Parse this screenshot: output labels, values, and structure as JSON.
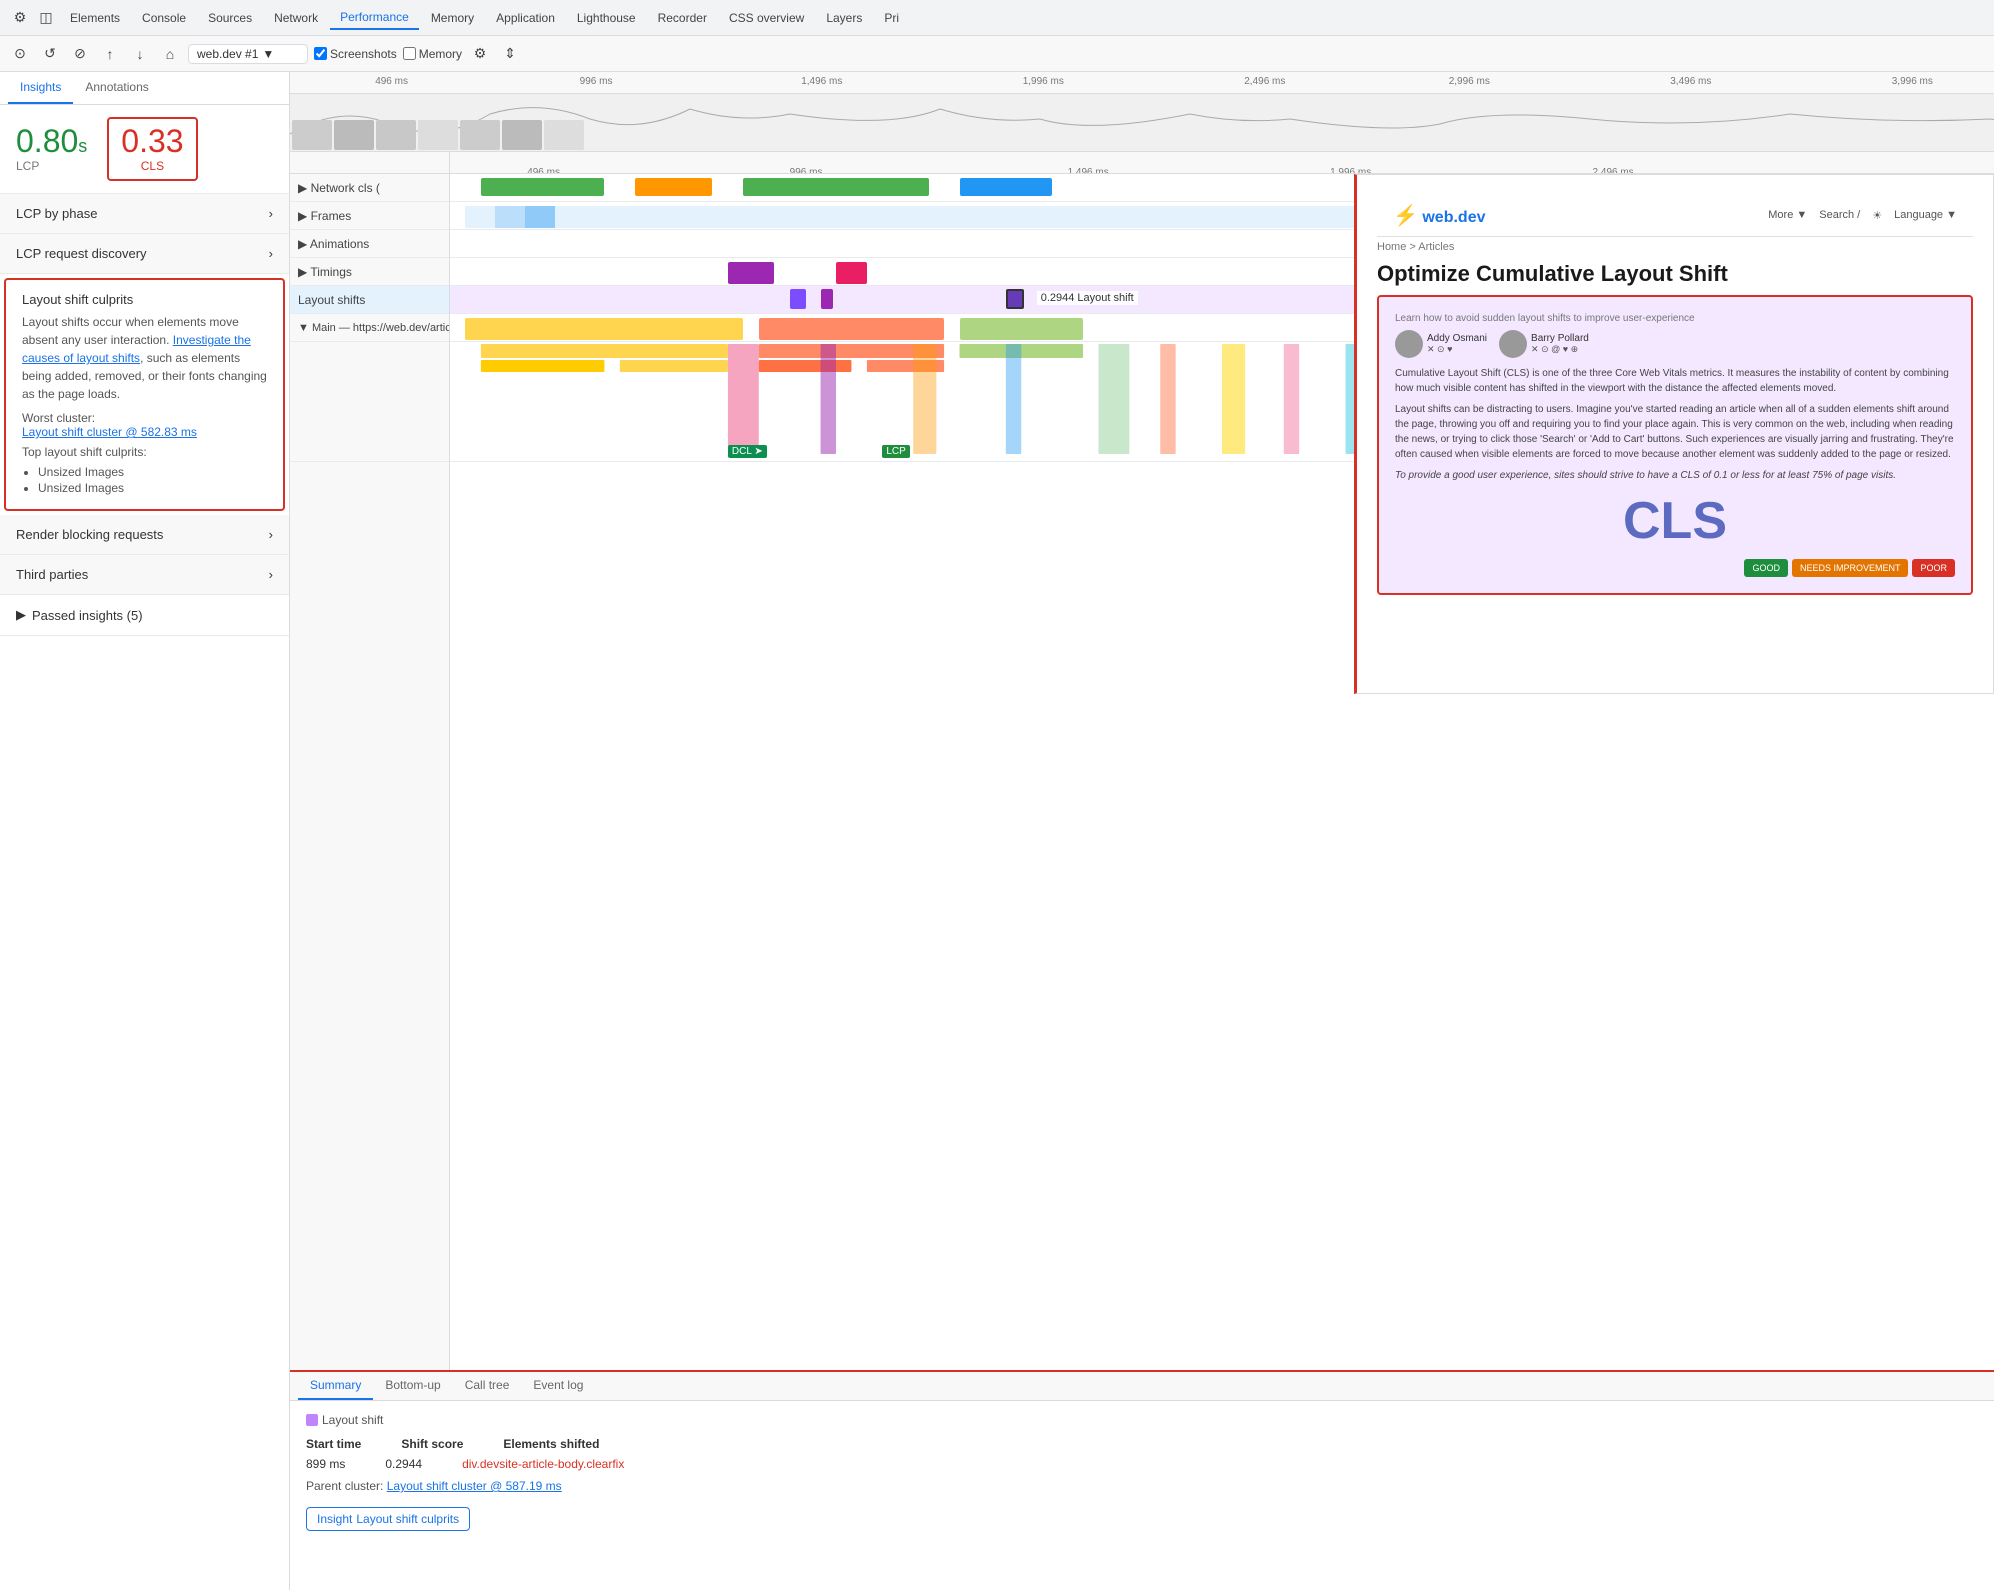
{
  "menuBar": {
    "items": [
      {
        "label": "Elements",
        "active": false
      },
      {
        "label": "Console",
        "active": false
      },
      {
        "label": "Sources",
        "active": false
      },
      {
        "label": "Network",
        "active": false
      },
      {
        "label": "Performance",
        "active": true
      },
      {
        "label": "Memory",
        "active": false
      },
      {
        "label": "Application",
        "active": false
      },
      {
        "label": "Lighthouse",
        "active": false
      },
      {
        "label": "Recorder",
        "active": false
      },
      {
        "label": "CSS overview",
        "active": false
      },
      {
        "label": "Layers",
        "active": false
      },
      {
        "label": "Pri",
        "active": false
      }
    ]
  },
  "toolbar": {
    "urlLabel": "web.dev #1",
    "screenshotsLabel": "Screenshots",
    "memoryLabel": "Memory"
  },
  "leftPanel": {
    "tabs": [
      {
        "label": "Insights",
        "active": true
      },
      {
        "label": "Annotations",
        "active": false
      }
    ],
    "metrics": {
      "lcp": {
        "value": "0.80",
        "unit": "s",
        "label": "LCP"
      },
      "cls": {
        "value": "0.33",
        "label": "CLS"
      }
    },
    "insights": [
      {
        "title": "LCP by phase",
        "active": false,
        "type": "collapsed"
      },
      {
        "title": "LCP request discovery",
        "active": false,
        "type": "collapsed"
      },
      {
        "title": "Layout shift culprits",
        "active": true,
        "type": "expanded",
        "body": "Layout shifts occur when elements move absent any user interaction.",
        "linkText": "Investigate the causes of layout shifts",
        "bodyAfterLink": ", such as elements being added, removed, or their fonts changing as the page loads.",
        "worstCluster": {
          "label": "Worst cluster:",
          "linkText": "Layout shift cluster @ 582.83 ms"
        },
        "topCulprits": {
          "label": "Top layout shift culprits:",
          "items": [
            "Unsized Images",
            "Unsized Images"
          ]
        }
      },
      {
        "title": "Render blocking requests",
        "active": false,
        "type": "collapsed"
      },
      {
        "title": "Third parties",
        "active": false,
        "type": "collapsed"
      }
    ],
    "passedInsights": {
      "label": "Passed insights (5)",
      "count": 5
    }
  },
  "timeline": {
    "rulerMarks": [
      "496 ms",
      "996 ms",
      "1,496 ms",
      "1,996 ms",
      "2,496 ms",
      "2,996 ms",
      "3,496 ms",
      "3,996 ms"
    ],
    "secondRulerMarks": [
      "496 ms",
      "996 ms",
      "1,496 ms",
      "1,996 ms",
      "2,496 ms"
    ],
    "tracks": [
      {
        "label": "▶ Network cls (",
        "indent": 0
      },
      {
        "label": "▶ Frames",
        "indent": 0
      },
      {
        "label": "▶ Animations",
        "indent": 0
      },
      {
        "label": "▶ Timings",
        "indent": 0
      },
      {
        "label": "Layout shifts",
        "indent": 0,
        "highlighted": true
      },
      {
        "label": "▼ Main — https://web.dev/articles/optim",
        "indent": 0
      }
    ],
    "layoutShiftLabel": "0.2944 Layout shift"
  },
  "screenshot": {
    "title": "web.dev",
    "navItems": [
      "More ▼",
      "Search /",
      "☀",
      "Language ▼"
    ],
    "breadcrumb": "Home > Articles",
    "articleTitle": "Optimize Cumulative Layout Shift",
    "bannerText": "Learn how to avoid sudden layout shifts to improve user-experience",
    "authors": [
      {
        "name": "Addy Osmani"
      },
      {
        "name": "Barry Pollard"
      }
    ],
    "bodyIntro": "Cumulative Layout Shift (CLS) is one of the three Core Web Vitals metrics. It measures the instability of content by combining how much visible content has shifted in the viewport with the distance the affected elements moved.",
    "body2": "Layout shifts can be distracting to users. Imagine you've started reading an article when all of a sudden elements shift around the page, throwing you off and requiring you to find your place again. This is very common on the web, including when reading the news, or trying to click those 'Search' or 'Add to Cart' buttons. Such experiences are visually jarring and frustrating. They're often caused when visible elements are forced to move because another element was suddenly added to the page or resized.",
    "body3": "To provide a good user experience, sites should strive to have a CLS of 0.1 or less for at least 75% of page visits.",
    "clsLabel": "CLS",
    "clsBars": [
      {
        "label": "GOOD",
        "color": "#1e8e3e"
      },
      {
        "label": "NEEDS IMPROVEMENT",
        "color": "#e37400"
      },
      {
        "label": "POOR",
        "color": "#d93025"
      }
    ]
  },
  "bottomPanel": {
    "tabs": [
      {
        "label": "Summary",
        "active": true
      },
      {
        "label": "Bottom-up",
        "active": false
      },
      {
        "label": "Call tree",
        "active": false
      },
      {
        "label": "Event log",
        "active": false
      }
    ],
    "summary": {
      "badgeLabel": "Layout shift",
      "startTime": {
        "label": "Start time",
        "value": "899 ms"
      },
      "shiftScore": {
        "label": "Shift score",
        "value": "0.2944"
      },
      "elementsShifted": {
        "label": "Elements shifted",
        "value": "div.devsite-article-body.clearfix"
      },
      "parentCluster": {
        "label": "Parent cluster:",
        "linkText": "Layout shift cluster @ 587.19 ms"
      },
      "insight": {
        "prefix": "Insight",
        "label": "Layout shift culprits"
      }
    }
  }
}
